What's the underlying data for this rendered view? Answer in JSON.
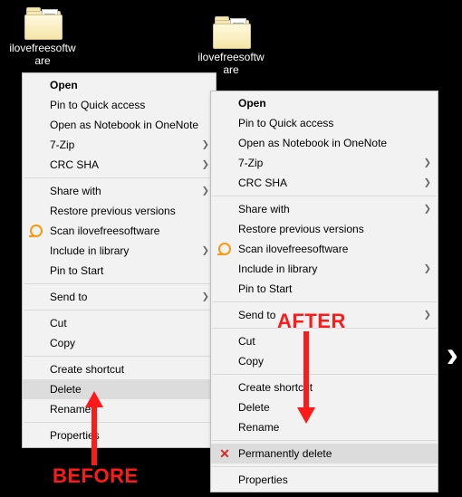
{
  "folders": {
    "left": {
      "label": "ilovefreesoftware"
    },
    "right": {
      "label": "ilovefreesoftware"
    }
  },
  "menu_before": {
    "items": [
      {
        "label": "Open",
        "bold": true
      },
      {
        "label": "Pin to Quick access"
      },
      {
        "label": "Open as Notebook in OneNote"
      },
      {
        "label": "7-Zip",
        "submenu": true
      },
      {
        "label": "CRC SHA",
        "submenu": true
      },
      {
        "sep": true
      },
      {
        "label": "Share with",
        "submenu": true
      },
      {
        "label": "Restore previous versions"
      },
      {
        "label": "Scan ilovefreesoftware",
        "icon": "orange"
      },
      {
        "label": "Include in library",
        "submenu": true
      },
      {
        "label": "Pin to Start"
      },
      {
        "sep": true
      },
      {
        "label": "Send to",
        "submenu": true
      },
      {
        "sep": true
      },
      {
        "label": "Cut"
      },
      {
        "label": "Copy"
      },
      {
        "sep": true
      },
      {
        "label": "Create shortcut"
      },
      {
        "label": "Delete",
        "hover": true
      },
      {
        "label": "Rename"
      },
      {
        "sep": true
      },
      {
        "label": "Properties"
      }
    ]
  },
  "menu_after": {
    "items": [
      {
        "label": "Open",
        "bold": true
      },
      {
        "label": "Pin to Quick access"
      },
      {
        "label": "Open as Notebook in OneNote"
      },
      {
        "label": "7-Zip",
        "submenu": true
      },
      {
        "label": "CRC SHA",
        "submenu": true
      },
      {
        "sep": true
      },
      {
        "label": "Share with",
        "submenu": true
      },
      {
        "label": "Restore previous versions"
      },
      {
        "label": "Scan ilovefreesoftware",
        "icon": "orange"
      },
      {
        "label": "Include in library",
        "submenu": true
      },
      {
        "label": "Pin to Start"
      },
      {
        "sep": true
      },
      {
        "label": "Send to",
        "submenu": true
      },
      {
        "sep": true
      },
      {
        "label": "Cut"
      },
      {
        "label": "Copy"
      },
      {
        "sep": true
      },
      {
        "label": "Create shortcut"
      },
      {
        "label": "Delete"
      },
      {
        "label": "Rename"
      },
      {
        "sep": true
      },
      {
        "label": "Permanently delete",
        "icon": "redx",
        "hover": true
      },
      {
        "sep": true
      },
      {
        "label": "Properties"
      }
    ]
  },
  "annotations": {
    "before": "BEFORE",
    "after": "AFTER"
  }
}
